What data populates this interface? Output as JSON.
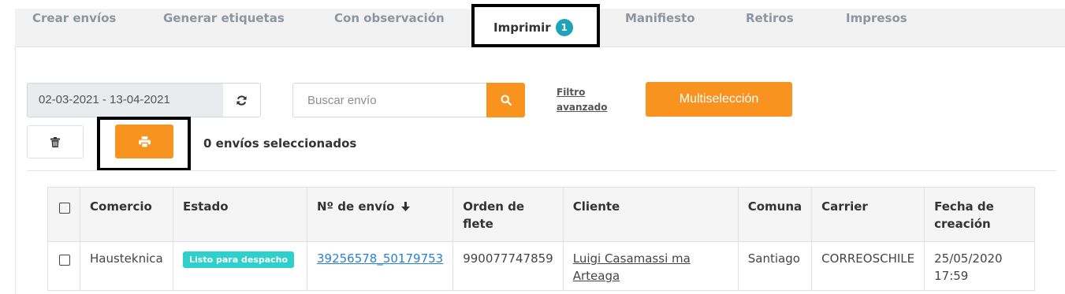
{
  "tabs": [
    {
      "label": "Crear envíos"
    },
    {
      "label": "Generar etiquetas"
    },
    {
      "label": "Con observación"
    },
    {
      "label": "Imprimir",
      "badge": "1"
    },
    {
      "label": "Manifiesto"
    },
    {
      "label": "Retiros"
    },
    {
      "label": "Impresos"
    }
  ],
  "toolbar": {
    "date_range": "02-03-2021 - 13-04-2021",
    "search_placeholder": "Buscar envío",
    "filter_link_line1": "Filtro",
    "filter_link_line2": "avanzado",
    "multiselect_label": "Multiselección",
    "selected_count": "0 envíos seleccionados"
  },
  "icons": {
    "refresh": "refresh-icon",
    "search": "search-icon",
    "trash": "trash-icon",
    "print": "print-icon"
  },
  "colors": {
    "accent": "#f7931e",
    "badge": "#1fa3b8",
    "status": "#2ed0cc",
    "link": "#2a7fcf"
  },
  "table": {
    "headers": {
      "comercio": "Comercio",
      "estado": "Estado",
      "envio": "Nº de envío",
      "orden_l1": "Orden de",
      "orden_l2": "flete",
      "cliente": "Cliente",
      "comuna": "Comuna",
      "carrier": "Carrier",
      "fecha_l1": "Fecha de",
      "fecha_l2": "creación"
    },
    "rows": [
      {
        "comercio": "Hausteknica",
        "estado": "Listo para despacho",
        "envio": "39256578_50179753",
        "orden": "990077747859",
        "cliente_l1": "Luigi Casamassi ma",
        "cliente_l2": "Arteaga",
        "comuna": "Santiago",
        "carrier": "CORREOSCHILE",
        "fecha_l1": "25/05/2020",
        "fecha_l2": "17:59"
      }
    ]
  }
}
